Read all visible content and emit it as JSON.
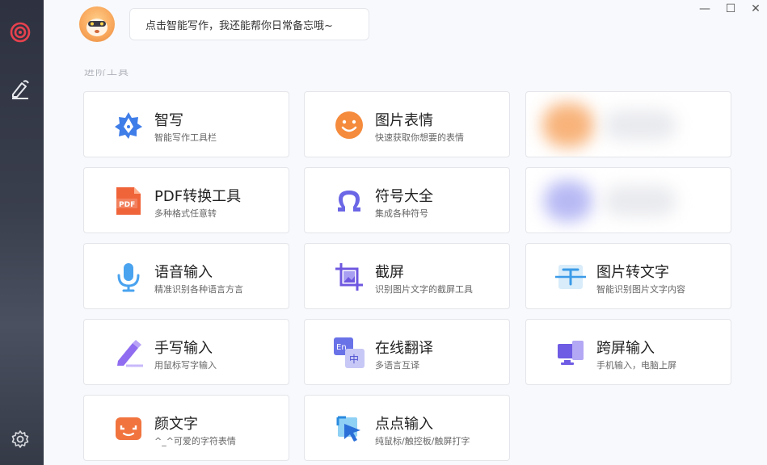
{
  "assistant": {
    "message": "点击智能写作，我还能帮你日常备忘哦~"
  },
  "section": {
    "title": "进阶工具"
  },
  "window": {
    "minimize": "—",
    "maximize": "☐",
    "close": "✕"
  },
  "tools": [
    {
      "id": "zhixie",
      "title": "智写",
      "subtitle": "智能写作工具栏",
      "icon": "pen-nib-icon"
    },
    {
      "id": "tupian-biaoqing",
      "title": "图片表情",
      "subtitle": "快速获取你想要的表情",
      "icon": "smiley-icon"
    },
    {
      "id": "pdf",
      "title": "PDF转换工具",
      "subtitle": "多种格式任意转",
      "icon": "pdf-icon"
    },
    {
      "id": "fuhao",
      "title": "符号大全",
      "subtitle": "集成各种符号",
      "icon": "omega-icon"
    },
    {
      "id": "yuyin",
      "title": "语音输入",
      "subtitle": "精准识别各种语言方言",
      "icon": "microphone-icon"
    },
    {
      "id": "jieping",
      "title": "截屏",
      "subtitle": "识别图片文字的截屏工具",
      "icon": "crop-icon"
    },
    {
      "id": "ocr",
      "title": "图片转文字",
      "subtitle": "智能识别图片文字内容",
      "icon": "scan-text-icon"
    },
    {
      "id": "shouxie",
      "title": "手写输入",
      "subtitle": "用鼠标写字输入",
      "icon": "pencil-icon"
    },
    {
      "id": "fanyi",
      "title": "在线翻译",
      "subtitle": "多语言互译",
      "icon": "translate-icon"
    },
    {
      "id": "kuaping",
      "title": "跨屏输入",
      "subtitle": "手机输入，电脑上屏",
      "icon": "multi-screen-icon"
    },
    {
      "id": "yanwenzi",
      "title": "颜文字",
      "subtitle": "^_^可爱的字符表情",
      "icon": "kaomoji-icon"
    },
    {
      "id": "diandian",
      "title": "点点输入",
      "subtitle": "纯鼠标/触控板/触屏打字",
      "icon": "click-cursor-icon"
    }
  ],
  "translate_icon_text": {
    "en": "En",
    "zh": "中"
  },
  "pdf_icon_text": "PDF"
}
